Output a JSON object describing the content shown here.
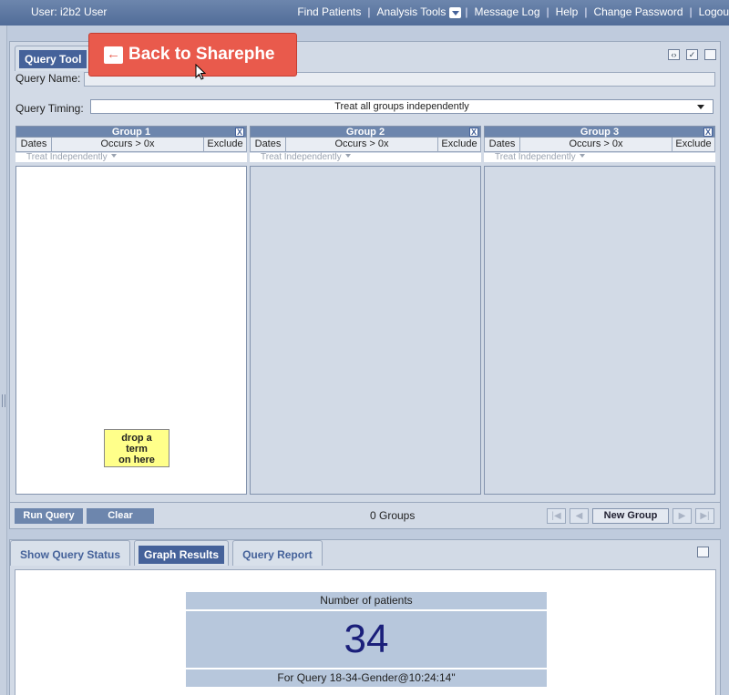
{
  "topbar": {
    "user": "User: i2b2 User",
    "nav": {
      "find_patients": "Find Patients",
      "analysis_tools": "Analysis Tools",
      "message_log": "Message Log",
      "help": "Help",
      "change_password": "Change Password",
      "logout": "Logou"
    },
    "separator": "|"
  },
  "overlay": {
    "back_label": "Back to Sharephe",
    "back_icon": "arrow-left-icon"
  },
  "query_tool": {
    "tab_label": "Query Tool",
    "name_label": "Query Name:",
    "name_value": "",
    "timing_label": "Query Timing:",
    "timing_value": "Treat all groups independently",
    "groups": [
      {
        "title": "Group 1",
        "dates": "Dates",
        "occurs": "Occurs > 0x",
        "exclude": "Exclude",
        "treat": "Treat Independently",
        "close": "X",
        "drop_hint": "drop a term on here"
      },
      {
        "title": "Group 2",
        "dates": "Dates",
        "occurs": "Occurs > 0x",
        "exclude": "Exclude",
        "treat": "Treat Independently",
        "close": "X"
      },
      {
        "title": "Group 3",
        "dates": "Dates",
        "occurs": "Occurs > 0x",
        "exclude": "Exclude",
        "treat": "Treat Independently",
        "close": "X"
      }
    ],
    "drop_lines": [
      "drop a",
      "term",
      "on here"
    ],
    "run_query": "Run Query",
    "clear": "Clear",
    "groups_count": "0 Groups",
    "new_group": "New Group"
  },
  "results": {
    "tabs": [
      {
        "label": "Show Query Status",
        "active": false
      },
      {
        "label": "Graph Results",
        "active": true
      },
      {
        "label": "Query Report",
        "active": false
      }
    ],
    "caption": "Number of patients",
    "count": "34",
    "footer": "For Query 18-34-Gender@10:24:14\""
  },
  "colors": {
    "accent": "#45629a",
    "header": "#6d86ad",
    "back_button": "#e95a4c",
    "count": "#1a1f7a",
    "drop_hint_bg": "#ffff8a"
  }
}
